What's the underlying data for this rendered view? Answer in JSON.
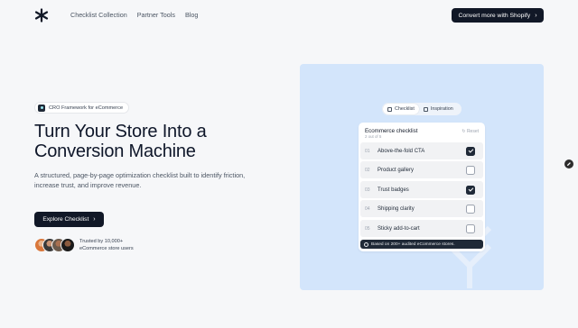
{
  "nav": {
    "links": [
      "Checklist Collection",
      "Partner Tools",
      "Blog"
    ],
    "cta_label": "Convert more with Shopify"
  },
  "hero": {
    "badge": "CRO Framework for eCommerce",
    "headline_line1": "Turn Your Store Into a",
    "headline_line2": "Conversion Machine",
    "subtext": "A structured, page-by-page optimization checklist built to identify friction, increase trust, and improve revenue.",
    "button_label": "Explore Checklist",
    "trust_line1": "Trusted by 10,000+",
    "trust_line2": "eCommerce store users"
  },
  "preview": {
    "tabs": [
      {
        "label": "Checklist",
        "active": true,
        "icon": "list-icon"
      },
      {
        "label": "Inspiration",
        "active": false,
        "icon": "image-icon"
      }
    ],
    "card_title": "Ecommerce checklist",
    "count": "2 out of 5",
    "reset_label": "Reset",
    "items": [
      {
        "num": "01",
        "label": "Above-the-fold CTA",
        "checked": true
      },
      {
        "num": "02",
        "label": "Product gallery",
        "checked": false
      },
      {
        "num": "03",
        "label": "Trust badges",
        "checked": true
      },
      {
        "num": "04",
        "label": "Shipping clarity",
        "checked": false
      },
      {
        "num": "05",
        "label": "Sticky add-to-cart",
        "checked": false
      }
    ],
    "footer_note": "Based on 200+ audited eCommerce stores."
  },
  "colors": {
    "primary": "#111827",
    "panel_bg": "#d3e5fb",
    "page_bg": "#f6f7f9"
  }
}
